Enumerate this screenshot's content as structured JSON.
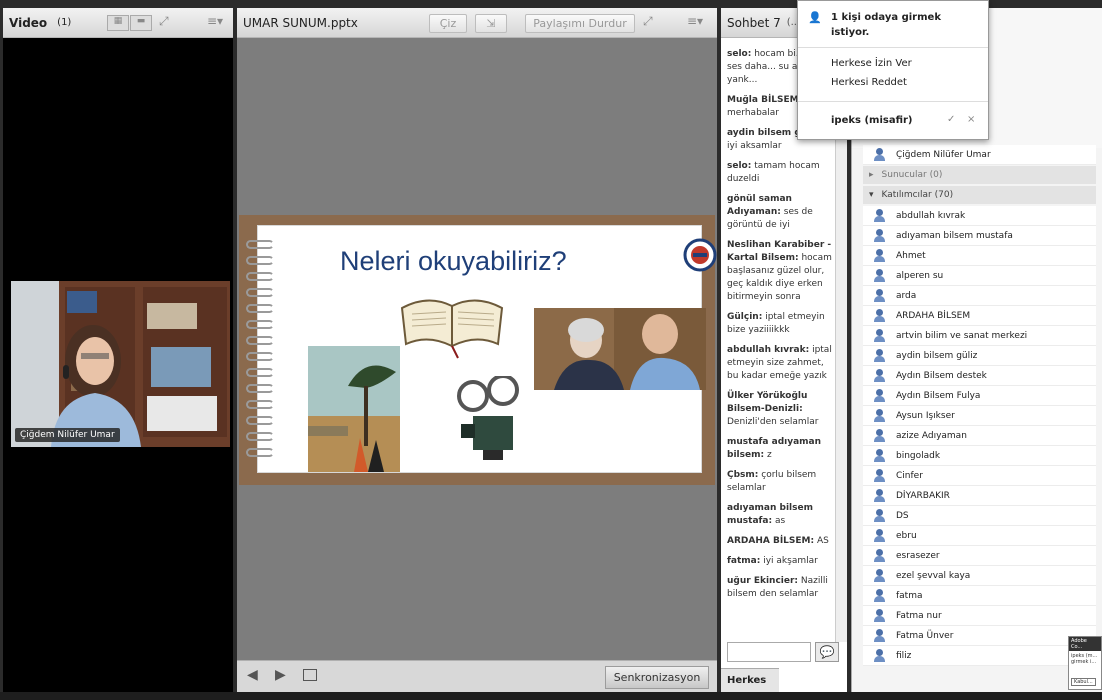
{
  "video": {
    "title": "Video",
    "count": "(1)",
    "participant_name": "Çiğdem Nilüfer Umar"
  },
  "share": {
    "title": "UMAR SUNUM.pptx",
    "draw_label": "Çiz",
    "stop_label": "Paylaşımı Durdur",
    "sync_label": "Senkronizasyon",
    "slide_title": "Neleri okuyabiliriz?"
  },
  "chat": {
    "title": "Sohbet 7",
    "title_suffix": "(...",
    "messages": [
      {
        "name": "selo:",
        "text": "hocam bi... önce ses daha... su an cok yank..."
      },
      {
        "name": "Muğla BİLSEM:",
        "text": "merhabalar"
      },
      {
        "name": "aydin bilsem  güliz:",
        "text": "iyi aksamlar"
      },
      {
        "name": "selo:",
        "text": "tamam hocam duzeldi"
      },
      {
        "name": "gönül saman Adıyaman:",
        "text": "ses de görüntü de iyi"
      },
      {
        "name": "Neslihan Karabiber - Kartal Bilsem:",
        "text": "hocam başlasanız güzel olur, geç kaldık diye erken bitirmeyin sonra"
      },
      {
        "name": "Gülçin:",
        "text": "iptal etmeyin bize yaziiiikkk"
      },
      {
        "name": "abdullah kıvrak:",
        "text": "iptal etmeyin size zahmet, bu kadar emeğe yazık"
      },
      {
        "name": "Ülker Yörükoğlu Bilsem-Denizli:",
        "text": "Denizli'den selamlar"
      },
      {
        "name": "mustafa adıyaman bilsem:",
        "text": "z"
      },
      {
        "name": "Çbsm:",
        "text": "çorlu bilsem selamlar"
      },
      {
        "name": "adıyaman bilsem mustafa:",
        "text": "as"
      },
      {
        "name": "ARDAHA BİLSEM:",
        "text": "AS"
      },
      {
        "name": "fatma:",
        "text": "iyi akşamlar"
      },
      {
        "name": "uğur  Ekincier:",
        "text": "Nazilli bilsem den selamlar"
      }
    ],
    "tab_label": "Herkes"
  },
  "attendees": {
    "host": "Çiğdem Nilüfer Umar",
    "presenters_label": "Sunucular (0)",
    "participants_label": "Katılımcılar (70)",
    "participants": [
      "abdullah kıvrak",
      "adıyaman bilsem mustafa",
      "Ahmet",
      "alperen su",
      "arda",
      "ARDAHA BİLSEM",
      "artvin bilim ve sanat merkezi",
      "aydin bilsem  güliz",
      "Aydın Bilsem destek",
      "Aydın Bilsem Fulya",
      "Aysun Işıkser",
      "azize Adıyaman",
      "bingoladk",
      "Cinfer",
      "DİYARBAKIR",
      "DS",
      "ebru",
      "esrasezer",
      "ezel şevval kaya",
      "fatma",
      "Fatma nur",
      "Fatma Ünver",
      "filiz"
    ]
  },
  "popup": {
    "message": "1 kişi odaya girmek istiyor.",
    "allow_all": "Herkese İzin Ver",
    "deny_all": "Herkesi Reddet",
    "guest": "ipeks (misafir)",
    "accept": "✓",
    "reject": "×"
  },
  "mini_popup": {
    "title": "Adobe Co...",
    "line1": "ipeks (m...",
    "line2": "girmek i...",
    "button": "Kabul..."
  }
}
